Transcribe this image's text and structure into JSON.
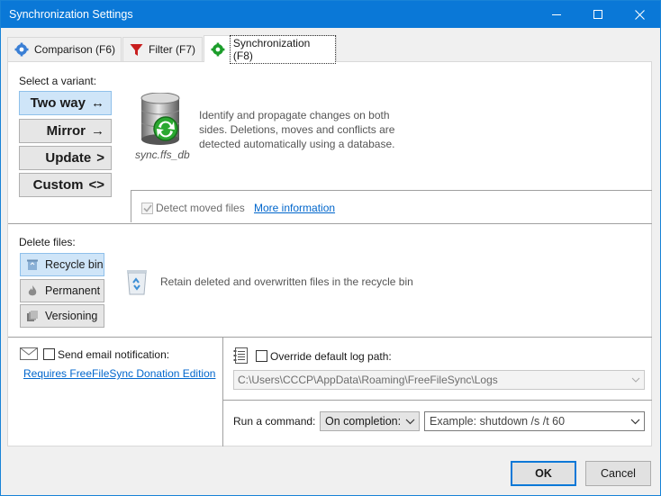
{
  "window": {
    "title": "Synchronization Settings",
    "accent_color": "#0a78d7"
  },
  "window_controls": {
    "minimize_icon": "minimize-icon",
    "maximize_icon": "maximize-icon",
    "close_icon": "close-icon"
  },
  "tabs": [
    {
      "label": "Comparison (F6)",
      "icon": "gear-blue-icon",
      "active": false
    },
    {
      "label": "Filter (F7)",
      "icon": "funnel-icon",
      "active": false
    },
    {
      "label": "Synchronization (F8)",
      "icon": "gear-green-icon",
      "active": true
    }
  ],
  "variant": {
    "heading": "Select a variant:",
    "buttons": [
      {
        "label": "Two way",
        "symbol": "↔",
        "active": true
      },
      {
        "label": "Mirror",
        "symbol": "→",
        "active": false
      },
      {
        "label": "Update",
        "symbol": ">",
        "active": false
      },
      {
        "label": "Custom",
        "symbol": "<>",
        "active": false
      }
    ],
    "db_caption": "sync.ffs_db",
    "description": "Identify and propagate changes on both sides. Deletions, moves and conflicts are detected automatically using a database.",
    "detect_moved_label": "Detect moved files",
    "detect_moved_checked": true,
    "more_info_link": "More information"
  },
  "delete": {
    "heading": "Delete files:",
    "buttons": [
      {
        "label": "Recycle bin",
        "icon": "recycle-bin-icon",
        "active": true
      },
      {
        "label": "Permanent",
        "icon": "flame-icon",
        "active": false
      },
      {
        "label": "Versioning",
        "icon": "versioning-icon",
        "active": false
      }
    ],
    "description": "Retain deleted and overwritten files in the recycle bin"
  },
  "email": {
    "label": "Send email notification:",
    "checked": false,
    "link": "Requires FreeFileSync Donation Edition"
  },
  "log": {
    "label": "Override default log path:",
    "checked": false,
    "path": "C:\\Users\\CCCP\\AppData\\Roaming\\FreeFileSync\\Logs"
  },
  "command": {
    "label": "Run a command:",
    "when_value": "On completion:",
    "command_placeholder": "Example: shutdown /s /t 60"
  },
  "footer": {
    "ok_label": "OK",
    "cancel_label": "Cancel"
  }
}
